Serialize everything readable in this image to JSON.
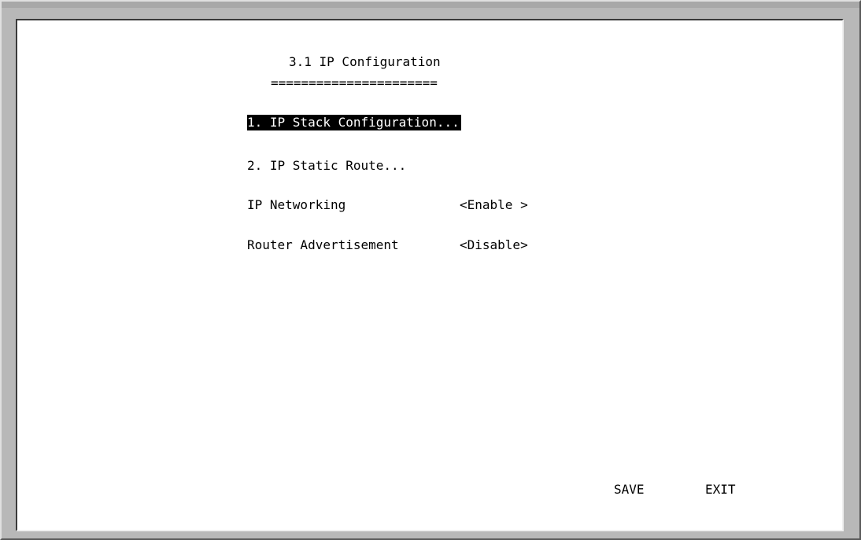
{
  "screen": {
    "title": "3.1 IP Configuration",
    "underline": "======================"
  },
  "menu": {
    "item1": "1. IP Stack Configuration...",
    "item2": "2. IP Static Route..."
  },
  "settings": {
    "ip_networking_label": "IP Networking",
    "ip_networking_value": "<Enable >",
    "router_adv_label": "Router Advertisement",
    "router_adv_value": "<Disable>"
  },
  "actions": {
    "save": "SAVE",
    "exit": "EXIT"
  },
  "colors": {
    "background": "#ffffff",
    "text": "#000000",
    "highlight_bg": "#000000",
    "highlight_fg": "#ffffff",
    "frame": "#b8b8b8"
  }
}
